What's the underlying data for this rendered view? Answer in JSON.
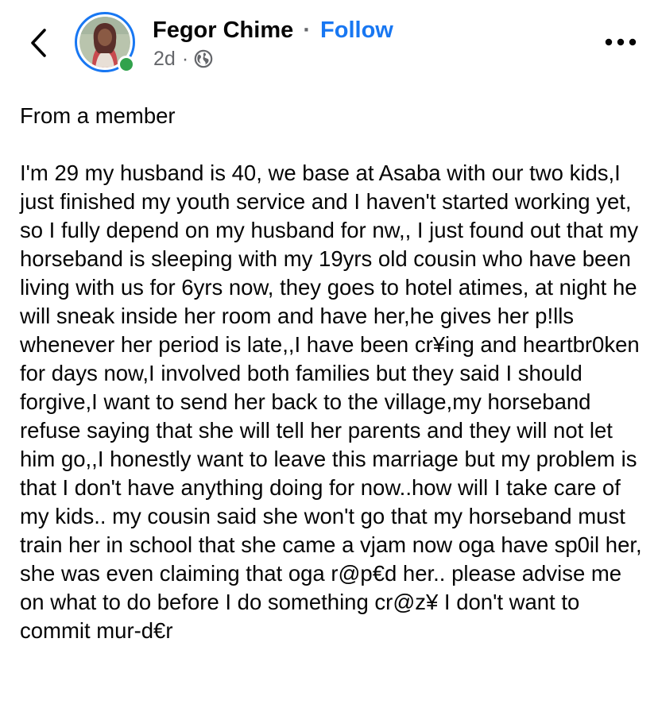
{
  "header": {
    "back_icon": "chevron-left-icon",
    "author_name": "Fegor Chime",
    "separator": "·",
    "follow_label": "Follow",
    "post_age": "2d",
    "meta_separator": "·",
    "privacy_icon": "globe-icon",
    "more_icon": "more-horizontal-icon",
    "online_status_color": "#31a24c",
    "story_ring_color": "#1877f2"
  },
  "post": {
    "intro": "From a member",
    "body": "I'm 29 my husband is 40, we base at Asaba with our two kids,I just finished my youth service and I haven't started working yet, so I fully depend on my husband for nw,, I just found out that my horseband is sleeping with my 19yrs old cousin who have been living with us for 6yrs now, they goes to hotel atimes, at night he will sneak inside her room and have her,he gives her p!lls whenever her period is late,,I have been cr¥ing and heartbr0ken for days now,I involved both families but they said I should forgive,I want to send her back to the village,my horseband refuse saying that she will tell her parents and they will not let him go,,I honestly want to leave this marriage but my problem is that I don't have anything doing for now..how will I take care of my kids.. my cousin said she won't go that my horseband must train her in school that she came a vjam now oga have sp0il her, she was even claiming that oga r@p€d her.. please advise me on what to do before I do something cr@z¥ I don't want to commit mur-d€r"
  }
}
